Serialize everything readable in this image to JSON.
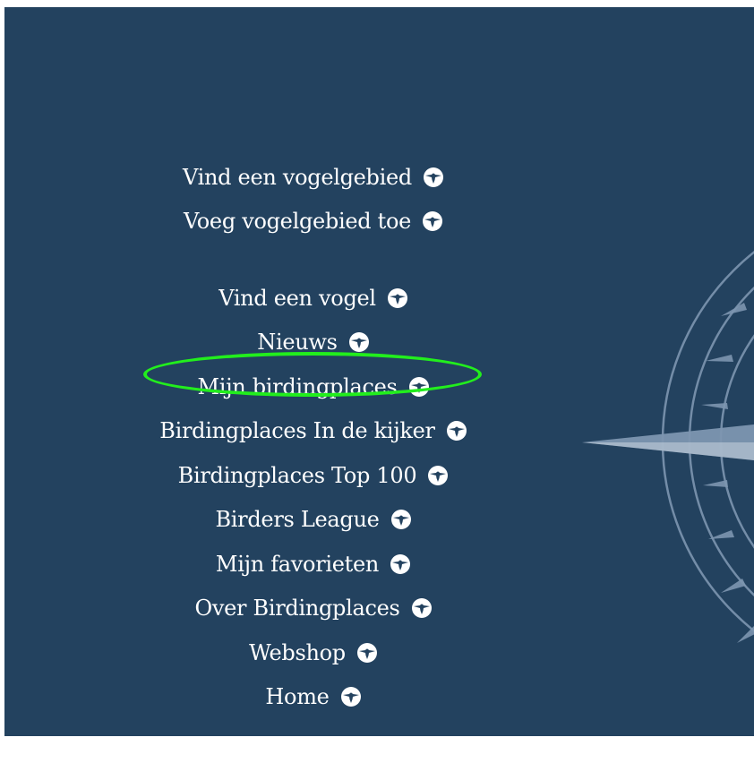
{
  "menu": {
    "items": [
      {
        "label": "Vind een vogelgebied",
        "icon": "bird-icon"
      },
      {
        "label": "Voeg vogelgebied toe",
        "icon": "bird-icon"
      },
      {
        "label": "Vind een vogel",
        "icon": "bird-icon"
      },
      {
        "label": "Nieuws",
        "icon": "bird-icon"
      },
      {
        "label": "Mijn birdingplaces",
        "icon": "bird-icon",
        "highlighted": true
      },
      {
        "label": "Birdingplaces In de kijker",
        "icon": "bird-icon"
      },
      {
        "label": "Birdingplaces Top 100",
        "icon": "bird-icon"
      },
      {
        "label": "Birders League",
        "icon": "bird-icon"
      },
      {
        "label": "Mijn favorieten",
        "icon": "bird-icon"
      },
      {
        "label": "Over Birdingplaces",
        "icon": "bird-icon"
      },
      {
        "label": "Webshop",
        "icon": "bird-icon"
      },
      {
        "label": "Home",
        "icon": "bird-icon"
      }
    ]
  },
  "colors": {
    "panel_background": "#23425f",
    "text": "#ffffff",
    "highlight": "#22ee1d",
    "compass": "#7d96b0"
  }
}
